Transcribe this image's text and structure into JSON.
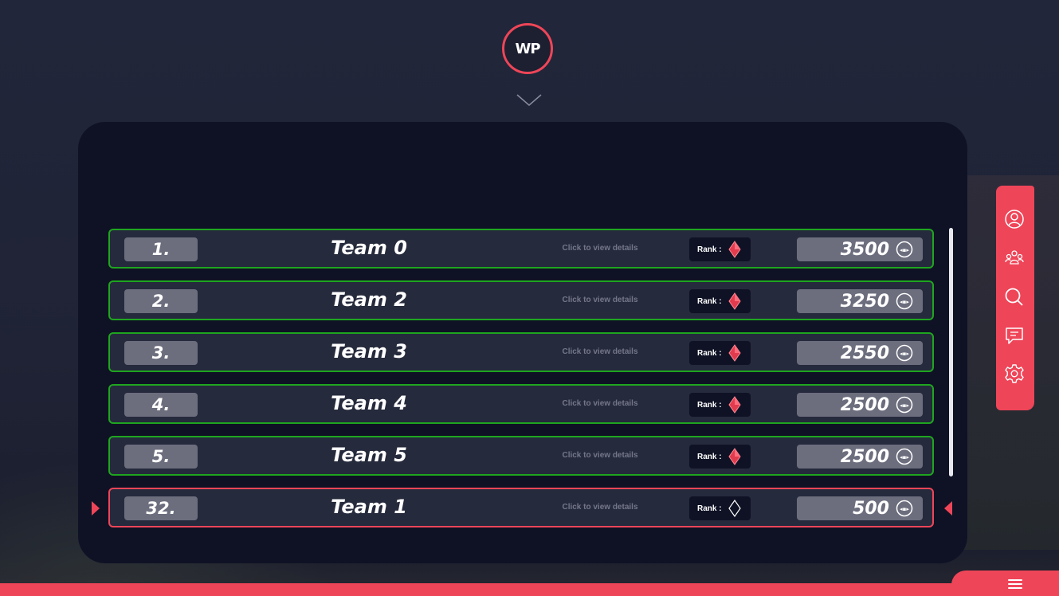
{
  "logo": {
    "text": "WP"
  },
  "leaderboard": {
    "rows": [
      {
        "position": "1.",
        "team": "Team 0",
        "details": "Click to view details",
        "rank_label": "Rank :",
        "rank_icon": "red-diamond-icon",
        "points": "3500"
      },
      {
        "position": "2.",
        "team": "Team 2",
        "details": "Click to view details",
        "rank_label": "Rank :",
        "rank_icon": "red-diamond-icon",
        "points": "3250"
      },
      {
        "position": "3.",
        "team": "Team 3",
        "details": "Click to view details",
        "rank_label": "Rank :",
        "rank_icon": "red-diamond-icon",
        "points": "2550"
      },
      {
        "position": "4.",
        "team": "Team 4",
        "details": "Click to view details",
        "rank_label": "Rank :",
        "rank_icon": "red-diamond-icon",
        "points": "2500"
      },
      {
        "position": "5.",
        "team": "Team 5",
        "details": "Click to view details",
        "rank_label": "Rank :",
        "rank_icon": "red-diamond-icon",
        "points": "2500"
      }
    ],
    "current_team": {
      "position": "32.",
      "team": "Team 1",
      "details": "Click to view details",
      "rank_label": "Rank :",
      "rank_icon": "outline-diamond-icon",
      "points": "500"
    }
  },
  "side_menu": [
    "profile-icon",
    "teams-icon",
    "search-icon",
    "chat-icon",
    "settings-icon"
  ],
  "colors": {
    "accent": "#ef4558",
    "row_border": "#1fa51f",
    "panel": "#0f1225",
    "row_bg": "#252a3c"
  }
}
